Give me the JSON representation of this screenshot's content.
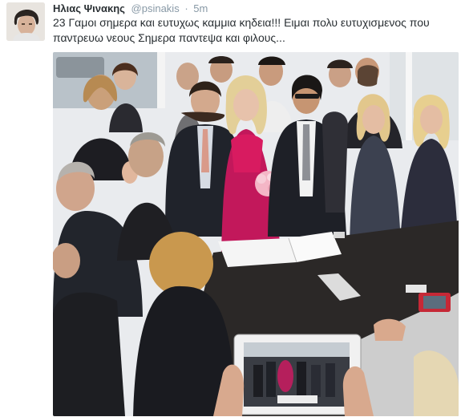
{
  "tweet": {
    "display_name": "Ηλιας Ψινακης",
    "handle": "@psinakis",
    "separator": "·",
    "timestamp": "5m",
    "text": "23 Γαμοι σημερα και ευτυχως καμμια κηδεια!!! Ειμαι πολυ ευτυχισμενος που παντρευω νεους Σημερα παντεψα και φιλους..."
  },
  "icons": {
    "avatar": "profile-photo",
    "photo": "attached-wedding-photo"
  },
  "colors": {
    "name": "#292f33",
    "meta": "#8899a6",
    "text": "#292f33",
    "dress": "#c2185b"
  }
}
